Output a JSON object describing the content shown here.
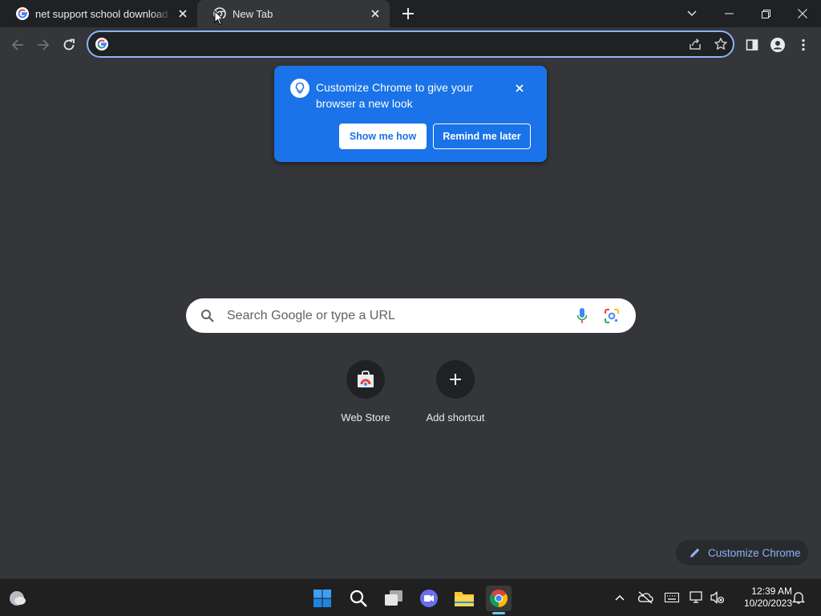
{
  "browser": {
    "tabs": [
      {
        "title": "net support school download - Google",
        "active": false,
        "icon": "google-icon"
      },
      {
        "title": "New Tab",
        "active": true,
        "icon": "chrome-newtab-icon"
      }
    ],
    "omnibox": {
      "value": "",
      "placeholder": ""
    }
  },
  "promo": {
    "text": "Customize Chrome to give your browser a new look",
    "primary_button": "Show me how",
    "secondary_button": "Remind me later"
  },
  "ntp": {
    "search_placeholder": "Search Google or type a URL",
    "shortcuts": [
      {
        "label": "Web Store",
        "icon": "web-store-icon"
      },
      {
        "label": "Add shortcut",
        "icon": "plus-icon"
      }
    ],
    "customize_label": "Customize Chrome"
  },
  "taskbar": {
    "time": "12:39 AM",
    "date": "10/20/2023",
    "apps": [
      "start-icon",
      "search-icon",
      "task-view-icon",
      "teams-chat-icon",
      "file-explorer-icon",
      "chrome-icon"
    ]
  },
  "colors": {
    "accent": "#1a73e8",
    "background": "#35363a",
    "frame": "#202124",
    "link": "#8ab4f8"
  }
}
